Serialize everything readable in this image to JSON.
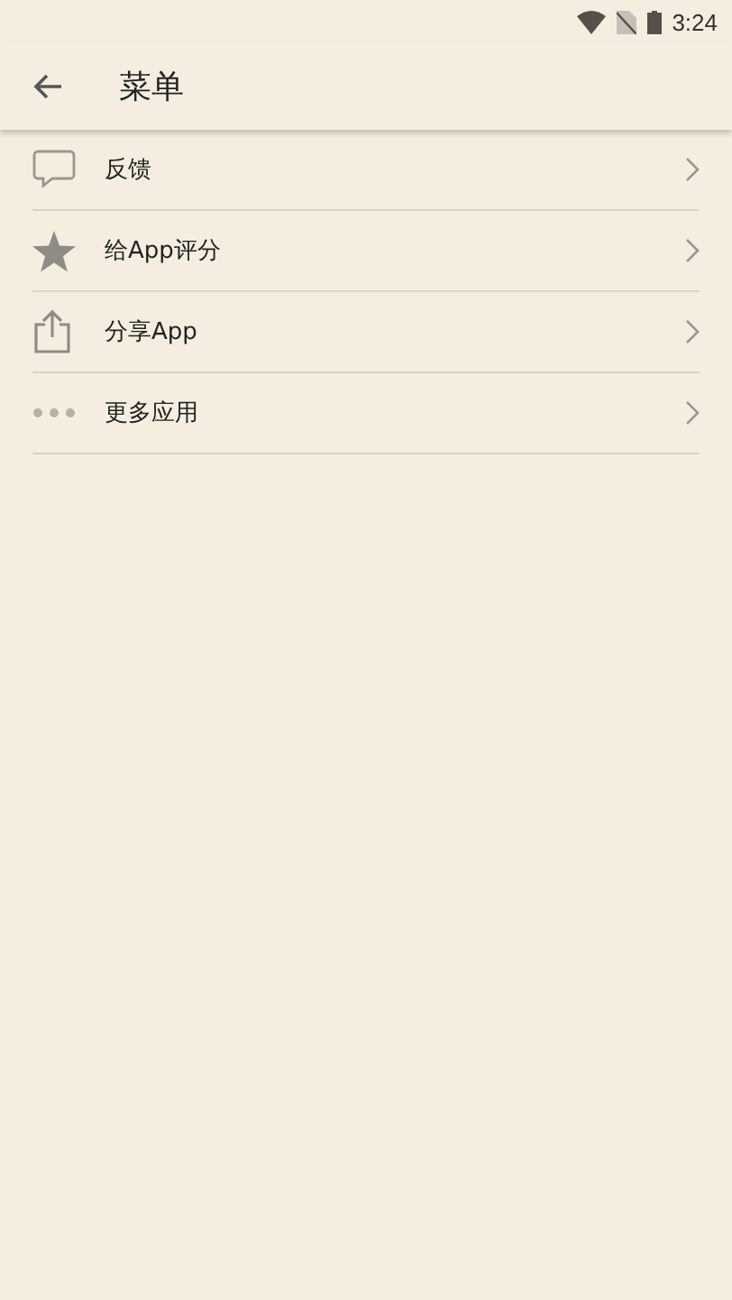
{
  "status_bar": {
    "time": "3:24"
  },
  "app_bar": {
    "title": "菜单"
  },
  "menu_items": [
    {
      "kind": "feedback",
      "label": "反馈"
    },
    {
      "kind": "rate",
      "label": "给App评分"
    },
    {
      "kind": "share",
      "label": "分享App"
    },
    {
      "kind": "more",
      "label": "更多应用"
    }
  ]
}
